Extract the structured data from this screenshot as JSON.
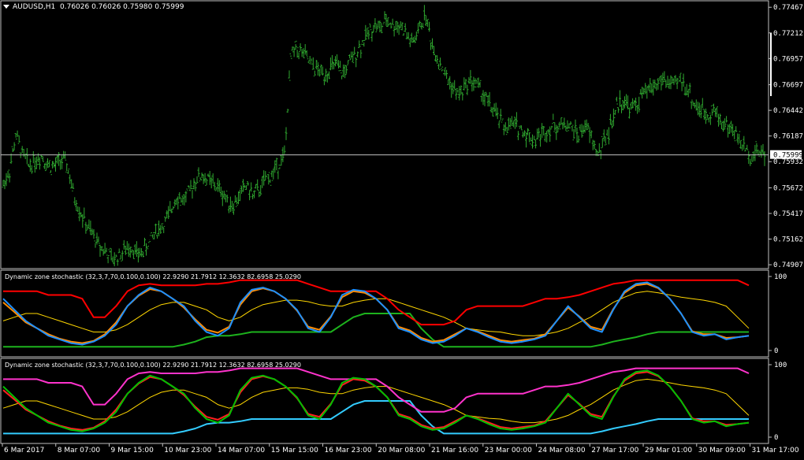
{
  "colors": {
    "background": "#000000",
    "frame": "#c0c0c0",
    "candles": "#2fa82f",
    "price_line": "#c0c0c0",
    "stoch_main_blue": "#1e90ff",
    "stoch_signal_orange": "#ff8c00",
    "zone_upper_red": "#ff0000",
    "zone_lower_green": "#1db31d",
    "zone_mid_yellow": "#ffd700",
    "stoch2_main": "#00c000",
    "stoch2_signal": "#ff2020",
    "zone2_upper_magenta": "#ff33cc",
    "zone2_lower_cyan": "#33ccff",
    "zone2_mid": "#ffd700"
  },
  "chart_data": [
    {
      "type": "candlestick",
      "title": "AUDUSD,H1  0.76026 0.76026 0.75980 0.75999",
      "symbol": "AUDUSD,H1",
      "ohlc_label": "0.76026 0.76026 0.75980 0.75999",
      "current_price_label": "0.75999",
      "current_price": 0.75999,
      "ylim": [
        0.749,
        0.775
      ],
      "yticks": [
        "0.77467",
        "0.77212",
        "0.76957",
        "0.76697",
        "0.76442",
        "0.76187",
        "0.75932",
        "0.75672",
        "0.75417",
        "0.75162",
        "0.74907"
      ],
      "ytick_values": [
        0.77467,
        0.77212,
        0.76957,
        0.76697,
        0.76442,
        0.76187,
        0.75932,
        0.75672,
        0.75417,
        0.75162,
        0.74907
      ],
      "close_path": [
        0.757,
        0.7585,
        0.762,
        0.76,
        0.759,
        0.7595,
        0.76,
        0.759,
        0.7588,
        0.7595,
        0.759,
        0.756,
        0.7545,
        0.753,
        0.752,
        0.751,
        0.7505,
        0.7495,
        0.75,
        0.7505,
        0.751,
        0.75,
        0.7505,
        0.7515,
        0.7525,
        0.753,
        0.754,
        0.756,
        0.7555,
        0.756,
        0.7575,
        0.758,
        0.7575,
        0.757,
        0.7565,
        0.7555,
        0.755,
        0.756,
        0.757,
        0.756,
        0.7565,
        0.7575,
        0.758,
        0.759,
        0.76,
        0.77,
        0.7705,
        0.77,
        0.769,
        0.7685,
        0.768,
        0.7685,
        0.769,
        0.768,
        0.769,
        0.77,
        0.771,
        0.772,
        0.773,
        0.7725,
        0.7735,
        0.7728,
        0.773,
        0.772,
        0.771,
        0.7725,
        0.774,
        0.771,
        0.7695,
        0.768,
        0.767,
        0.766,
        0.7665,
        0.7675,
        0.767,
        0.766,
        0.765,
        0.764,
        0.763,
        0.7628,
        0.763,
        0.7625,
        0.762,
        0.7615,
        0.762,
        0.7625,
        0.763,
        0.7628,
        0.7632,
        0.7625,
        0.762,
        0.763,
        0.7615,
        0.76,
        0.7615,
        0.763,
        0.765,
        0.7655,
        0.7645,
        0.765,
        0.766,
        0.7665,
        0.767,
        0.7675,
        0.7672,
        0.7668,
        0.7675,
        0.7665,
        0.765,
        0.7645,
        0.764,
        0.7645,
        0.7635,
        0.763,
        0.7625,
        0.7615,
        0.7605,
        0.76,
        0.7605,
        0.76
      ],
      "xticks": [
        "6 Mar 2017",
        "8 Mar 07:00",
        "9 Mar 15:00",
        "10 Mar 23:00",
        "14 Mar 07:00",
        "15 Mar 15:00",
        "16 Mar 23:00",
        "20 Mar 08:00",
        "21 Mar 16:00",
        "23 Mar 00:00",
        "24 Mar 08:00",
        "27 Mar 17:00",
        "29 Mar 01:00",
        "30 Mar 09:00",
        "31 Mar 17:00"
      ]
    },
    {
      "type": "line",
      "title": "Dynamic zone stochastic (32,3,7,70,0.100,0.100) 22.9290 21.7912 12.3632 82.6958 25.0290",
      "yticks": [
        "100",
        "0"
      ],
      "ylim": [
        0,
        100
      ],
      "series": [
        {
          "key": "main",
          "color_key": "stoch_main_blue",
          "values": [
            70,
            55,
            40,
            30,
            20,
            15,
            10,
            8,
            12,
            20,
            35,
            60,
            75,
            85,
            80,
            70,
            60,
            40,
            25,
            20,
            30,
            65,
            82,
            85,
            80,
            70,
            55,
            30,
            25,
            45,
            75,
            82,
            80,
            70,
            55,
            30,
            25,
            15,
            10,
            12,
            20,
            30,
            25,
            18,
            12,
            10,
            12,
            15,
            20,
            40,
            60,
            45,
            30,
            25,
            55,
            80,
            90,
            92,
            85,
            70,
            50,
            25,
            20,
            22,
            15,
            18,
            20
          ]
        },
        {
          "key": "signal",
          "color_key": "stoch_signal_orange",
          "values": [
            65,
            52,
            38,
            30,
            22,
            16,
            12,
            10,
            13,
            22,
            38,
            60,
            74,
            83,
            80,
            70,
            58,
            42,
            28,
            24,
            32,
            62,
            80,
            84,
            80,
            70,
            54,
            32,
            28,
            46,
            72,
            80,
            78,
            70,
            55,
            32,
            27,
            17,
            12,
            14,
            22,
            30,
            26,
            20,
            14,
            12,
            14,
            16,
            22,
            40,
            58,
            46,
            32,
            28,
            56,
            78,
            88,
            90,
            84,
            70,
            50,
            26,
            22,
            22,
            17,
            18,
            20
          ]
        },
        {
          "key": "upper",
          "color_key": "zone_upper_red",
          "values": [
            80,
            80,
            80,
            80,
            75,
            75,
            75,
            70,
            45,
            45,
            60,
            80,
            88,
            90,
            88,
            88,
            88,
            88,
            90,
            90,
            92,
            95,
            95,
            95,
            95,
            95,
            95,
            90,
            85,
            80,
            80,
            80,
            80,
            80,
            70,
            55,
            45,
            35,
            35,
            35,
            40,
            55,
            60,
            60,
            60,
            60,
            60,
            65,
            70,
            70,
            72,
            75,
            80,
            85,
            90,
            92,
            95,
            95,
            95,
            95,
            95,
            95,
            95,
            95,
            95,
            95,
            88
          ]
        },
        {
          "key": "lower",
          "color_key": "zone_lower_green",
          "values": [
            5,
            5,
            5,
            5,
            5,
            5,
            5,
            5,
            5,
            5,
            5,
            5,
            5,
            5,
            5,
            5,
            8,
            12,
            18,
            20,
            20,
            22,
            25,
            25,
            25,
            25,
            25,
            25,
            25,
            25,
            35,
            45,
            50,
            50,
            50,
            50,
            50,
            30,
            15,
            5,
            5,
            5,
            5,
            5,
            5,
            5,
            5,
            5,
            5,
            5,
            5,
            5,
            5,
            8,
            12,
            15,
            18,
            22,
            25,
            25,
            25,
            25,
            25,
            25,
            25,
            25,
            25
          ]
        },
        {
          "key": "mid",
          "color_key": "zone_mid_yellow",
          "values": [
            40,
            45,
            50,
            50,
            45,
            40,
            35,
            30,
            25,
            25,
            28,
            35,
            45,
            55,
            62,
            65,
            65,
            60,
            55,
            45,
            40,
            45,
            55,
            62,
            65,
            68,
            68,
            66,
            62,
            60,
            60,
            65,
            68,
            70,
            70,
            65,
            60,
            55,
            50,
            45,
            38,
            30,
            28,
            26,
            25,
            22,
            20,
            20,
            22,
            25,
            30,
            38,
            45,
            55,
            65,
            72,
            78,
            80,
            78,
            75,
            72,
            70,
            68,
            65,
            60,
            45,
            30
          ]
        }
      ]
    },
    {
      "type": "line",
      "title": "Dynamic zone stochastic (32,3,7,70,0.100,0.100) 22.9290 21.7912 12.3632 82.6958 25.0290",
      "yticks": [
        "100",
        "0"
      ],
      "ylim": [
        0,
        100
      ],
      "series": [
        {
          "key": "main",
          "color_key": "stoch2_main",
          "values": [
            70,
            55,
            40,
            30,
            20,
            15,
            10,
            8,
            12,
            20,
            35,
            60,
            75,
            85,
            80,
            70,
            60,
            40,
            25,
            20,
            30,
            65,
            82,
            85,
            80,
            70,
            55,
            30,
            25,
            45,
            75,
            82,
            80,
            70,
            55,
            30,
            25,
            15,
            10,
            12,
            20,
            30,
            25,
            18,
            12,
            10,
            12,
            15,
            20,
            40,
            60,
            45,
            30,
            25,
            55,
            80,
            90,
            92,
            85,
            70,
            50,
            25,
            20,
            22,
            15,
            18,
            20
          ]
        },
        {
          "key": "signal",
          "color_key": "stoch2_signal",
          "values": [
            65,
            52,
            38,
            30,
            22,
            16,
            12,
            10,
            13,
            22,
            38,
            60,
            74,
            83,
            80,
            70,
            58,
            42,
            28,
            24,
            32,
            62,
            80,
            84,
            80,
            70,
            54,
            32,
            28,
            46,
            72,
            80,
            78,
            70,
            55,
            32,
            27,
            17,
            12,
            14,
            22,
            30,
            26,
            20,
            14,
            12,
            14,
            16,
            22,
            40,
            58,
            46,
            32,
            28,
            56,
            78,
            88,
            90,
            84,
            70,
            50,
            26,
            22,
            22,
            17,
            18,
            20
          ]
        },
        {
          "key": "upper",
          "color_key": "zone2_upper_magenta",
          "values": [
            80,
            80,
            80,
            80,
            75,
            75,
            75,
            70,
            45,
            45,
            60,
            80,
            88,
            90,
            88,
            88,
            88,
            88,
            90,
            90,
            92,
            95,
            95,
            95,
            95,
            95,
            95,
            90,
            85,
            80,
            80,
            80,
            80,
            80,
            70,
            55,
            45,
            35,
            35,
            35,
            40,
            55,
            60,
            60,
            60,
            60,
            60,
            65,
            70,
            70,
            72,
            75,
            80,
            85,
            90,
            92,
            95,
            95,
            95,
            95,
            95,
            95,
            95,
            95,
            95,
            95,
            88
          ]
        },
        {
          "key": "lower",
          "color_key": "zone2_lower_cyan",
          "values": [
            5,
            5,
            5,
            5,
            5,
            5,
            5,
            5,
            5,
            5,
            5,
            5,
            5,
            5,
            5,
            5,
            8,
            12,
            18,
            20,
            20,
            22,
            25,
            25,
            25,
            25,
            25,
            25,
            25,
            25,
            35,
            45,
            50,
            50,
            50,
            50,
            50,
            30,
            15,
            5,
            5,
            5,
            5,
            5,
            5,
            5,
            5,
            5,
            5,
            5,
            5,
            5,
            5,
            8,
            12,
            15,
            18,
            22,
            25,
            25,
            25,
            25,
            25,
            25,
            25,
            25,
            25
          ]
        },
        {
          "key": "mid",
          "color_key": "zone2_mid",
          "values": [
            40,
            45,
            50,
            50,
            45,
            40,
            35,
            30,
            25,
            25,
            28,
            35,
            45,
            55,
            62,
            65,
            65,
            60,
            55,
            45,
            40,
            45,
            55,
            62,
            65,
            68,
            68,
            66,
            62,
            60,
            60,
            65,
            68,
            70,
            70,
            65,
            60,
            55,
            50,
            45,
            38,
            30,
            28,
            26,
            25,
            22,
            20,
            20,
            22,
            25,
            30,
            38,
            45,
            55,
            65,
            72,
            78,
            80,
            78,
            75,
            72,
            70,
            68,
            65,
            60,
            45,
            30
          ]
        }
      ]
    }
  ]
}
